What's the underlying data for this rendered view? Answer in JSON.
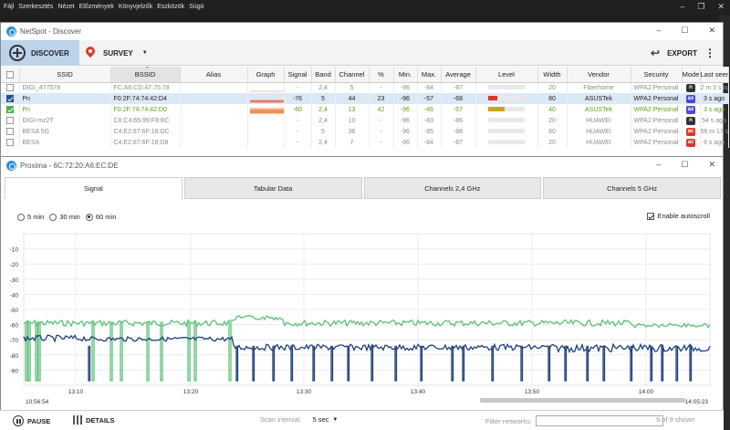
{
  "host": {
    "menu": [
      "Fájl",
      "Szerkesztés",
      "Nézet",
      "Előzmények",
      "Könyvjelzők",
      "Eszközök",
      "Súgó"
    ],
    "window_controls": [
      "–",
      "❐",
      "✕"
    ]
  },
  "netspot": {
    "title": "NetSpot - Discover",
    "window_controls": [
      "–",
      "☐",
      "✕"
    ],
    "toolbar": {
      "discover": "DISCOVER",
      "survey": "SURVEY",
      "export": "EXPORT"
    },
    "columns": [
      "SSID",
      "BSSID",
      "Alias",
      "Graph",
      "Signal",
      "Band",
      "Channel",
      "%",
      "Min.",
      "Max.",
      "Average",
      "Level",
      "Width",
      "Vendor",
      "Security",
      "Mode",
      "Last seen"
    ],
    "rows": [
      {
        "ssid": "DIGI_477578",
        "bssid": "FC:A6:CD:47:75:78",
        "signal": "-",
        "band": "2,4",
        "channel": "5",
        "pct": "-",
        "min": "-96",
        "max": "-84",
        "avg": "-87",
        "level": 0,
        "width": "20",
        "vendor": "Fiberhome",
        "security": "WPA2 Personal",
        "mode": "n",
        "last": "2 m 3 s ago",
        "checked": "none",
        "style": "dim"
      },
      {
        "ssid": "Pn",
        "bssid": "F0:2F:74:74:42:D4",
        "signal": "-76",
        "band": "5",
        "channel": "44",
        "pct": "23",
        "min": "-96",
        "max": "-57",
        "avg": "-68",
        "level": 0.25,
        "level_color": "#d9362b",
        "width": "80",
        "vendor": "ASUSTek",
        "security": "WPA2 Personal",
        "mode": "ax",
        "last": "3 s ago",
        "checked": "blue",
        "style": "sel"
      },
      {
        "ssid": "Pn",
        "bssid": "F0:2F:74:74:42:D0",
        "signal": "-60",
        "band": "2,4",
        "channel": "13",
        "pct": "42",
        "min": "-96",
        "max": "-46",
        "avg": "-57",
        "level": 0.45,
        "level_color": "#c9a227",
        "width": "40",
        "vendor": "ASUSTek",
        "security": "WPA2 Personal",
        "mode": "ax",
        "last": "3 s ago",
        "checked": "green",
        "style": "green"
      },
      {
        "ssid": "DIGI-mz2T",
        "bssid": "C8:C4:65:99:F8:BC",
        "signal": "-",
        "band": "2,4",
        "channel": "10",
        "pct": "-",
        "min": "-96",
        "max": "-83",
        "avg": "-86",
        "level": 0,
        "width": "20",
        "vendor": "HUAWEI",
        "security": "WPA2 Personal",
        "mode": "n",
        "last": "54 s ago",
        "checked": "none",
        "style": "dim"
      },
      {
        "ssid": "BESA 5G",
        "bssid": "C4:E2:87:6F:18:DC",
        "signal": "-",
        "band": "5",
        "channel": "36",
        "pct": "-",
        "min": "-96",
        "max": "-85",
        "avg": "-88",
        "level": 0,
        "width": "80",
        "vendor": "HUAWEI",
        "security": "WPA2 Personal",
        "mode": "ac",
        "last": "56 m 17 s ago",
        "checked": "none",
        "style": "dim"
      },
      {
        "ssid": "BESA",
        "bssid": "C4:E2:87:6F:18:D8",
        "signal": "-",
        "band": "2,4",
        "channel": "7",
        "pct": "-",
        "min": "-96",
        "max": "-84",
        "avg": "-87",
        "level": 0,
        "width": "20",
        "vendor": "HUAWEI",
        "security": "WPA2 Personal",
        "mode": "ac",
        "last": "9 s ago",
        "checked": "none",
        "style": "dim"
      }
    ]
  },
  "proxima": {
    "title": "Proxima - 6C:72:20:A6:EC:DE",
    "window_controls": [
      "–",
      "☐",
      "✕"
    ],
    "tabs": [
      "Signal",
      "Tabular Data",
      "Channels 2,4 GHz",
      "Channels 5 GHz"
    ],
    "ranges": [
      "5 min",
      "30 min",
      "60 min"
    ],
    "selected_range": "60 min",
    "autoscroll_label": "Enable autoscroll",
    "start_time": "10:56:54",
    "end_time": "14:05:23"
  },
  "statusbar": {
    "pause": "PAUSE",
    "details": "DETAILS",
    "scan_interval_label": "Scan interval:",
    "scan_interval_value": "5 sec",
    "filter_label": "Filter networks:",
    "count": "9 of 9 shown"
  },
  "chart_data": {
    "type": "line",
    "x_ticks": [
      "13:10",
      "13:20",
      "13:30",
      "13:40",
      "13:50",
      "14:00"
    ],
    "y_ticks": [
      -10,
      -20,
      -30,
      -40,
      -50,
      -60,
      -70,
      -80,
      -90
    ],
    "ylim": [
      -100,
      0
    ],
    "grid": true,
    "series": [
      {
        "color": "#5cc07a"
      },
      {
        "color": "#1f3f7a"
      }
    ]
  },
  "colors": {
    "accent": "#2b8fd6",
    "selection": "#dbe8f5",
    "green_series": "#5cc07a",
    "blue_series": "#1f3f7a"
  }
}
